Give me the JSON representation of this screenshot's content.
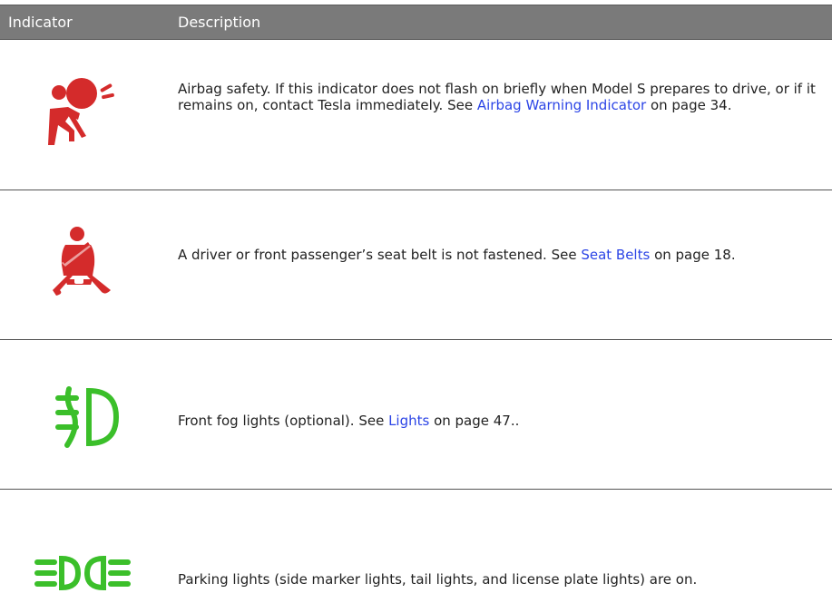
{
  "header": {
    "col_indicator": "Indicator",
    "col_description": "Description"
  },
  "colors": {
    "header_bg": "#7a7a7a",
    "link": "#2c45e6",
    "icon_red": "#d42b2b",
    "icon_green": "#3bbf2a"
  },
  "rows": [
    {
      "icon": "airbag-icon",
      "text_before": "Airbag safety. If this indicator does not flash on briefly when Model S prepares to drive, or if it remains on, contact Tesla immediately. See ",
      "link": "Airbag Warning Indicator",
      "text_after": " on page 34."
    },
    {
      "icon": "seatbelt-icon",
      "text_before": "A driver or front passenger’s seat belt is not fastened. See ",
      "link": "Seat Belts",
      "text_after": " on page 18."
    },
    {
      "icon": "fog-light-icon",
      "text_before": "Front fog lights (optional). See ",
      "link": "Lights",
      "text_after": " on page 47.."
    },
    {
      "icon": "parking-lights-icon",
      "text_before": "Parking lights (side marker lights, tail lights, and license plate lights) are on.",
      "link": "",
      "text_after": ""
    }
  ]
}
